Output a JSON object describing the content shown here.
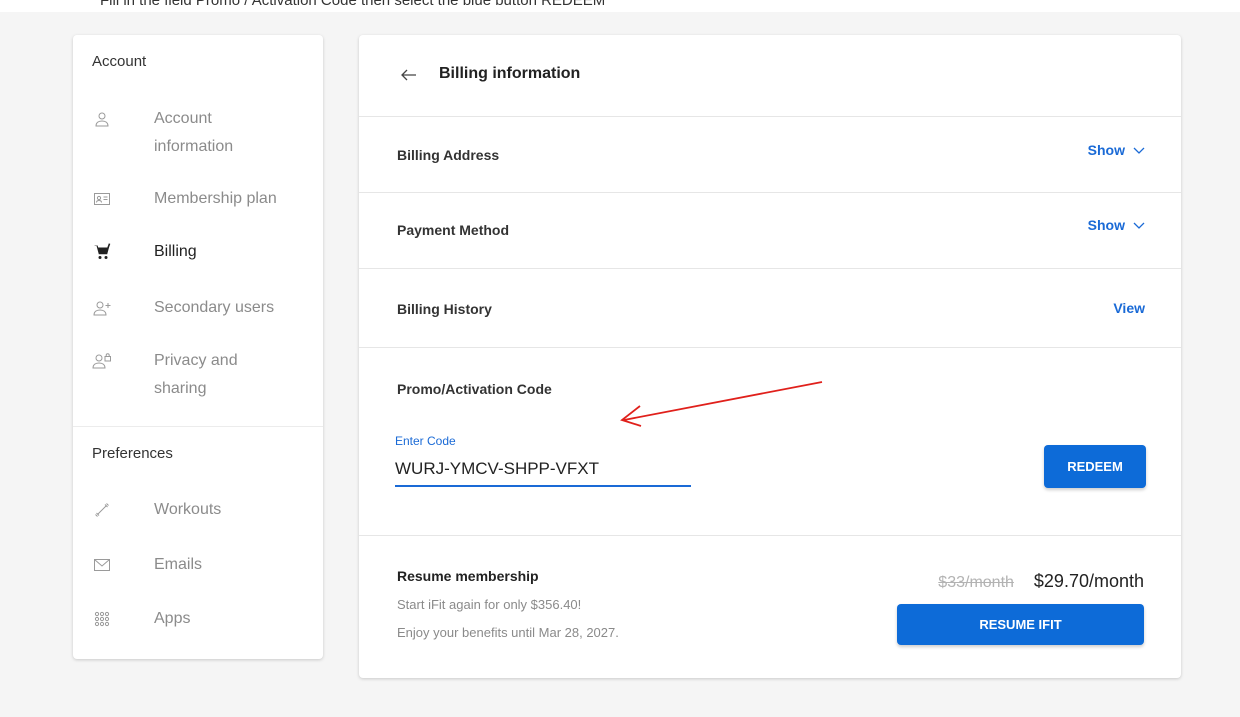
{
  "instruction": "Fill in the field Promo / Activation Code then select the blue button REDEEM",
  "sidebar": {
    "account_heading": "Account",
    "preferences_heading": "Preferences",
    "items": [
      {
        "label": "Account\ninformation",
        "icon": "user-icon"
      },
      {
        "label": "Membership plan",
        "icon": "id-card-icon"
      },
      {
        "label": "Billing",
        "icon": "cart-icon",
        "active": true
      },
      {
        "label": "Secondary users",
        "icon": "add-user-icon"
      },
      {
        "label": "Privacy and\nsharing",
        "icon": "user-lock-icon"
      }
    ],
    "pref_items": [
      {
        "label": "Workouts",
        "icon": "dumbbell-icon"
      },
      {
        "label": "Emails",
        "icon": "envelope-icon"
      },
      {
        "label": "Apps",
        "icon": "grid-icon"
      }
    ]
  },
  "main": {
    "title": "Billing information",
    "billing_address": {
      "label": "Billing Address",
      "action": "Show"
    },
    "payment_method": {
      "label": "Payment Method",
      "action": "Show"
    },
    "billing_history": {
      "label": "Billing History",
      "action": "View"
    },
    "promo": {
      "label": "Promo/Activation Code",
      "field_label": "Enter Code",
      "value": "WURJ-YMCV-SHPP-VFXT",
      "button": "REDEEM"
    },
    "resume": {
      "title": "Resume membership",
      "line1": "Start iFit again for only $356.40!",
      "line2": "Enjoy your benefits until Mar 28, 2027.",
      "old_price": "$33/month",
      "new_price": "$29.70/month",
      "button": "RESUME IFIT"
    }
  },
  "colors": {
    "accent": "#0d6bd8",
    "link": "#1a6ad6",
    "annotation": "#e0201b"
  }
}
